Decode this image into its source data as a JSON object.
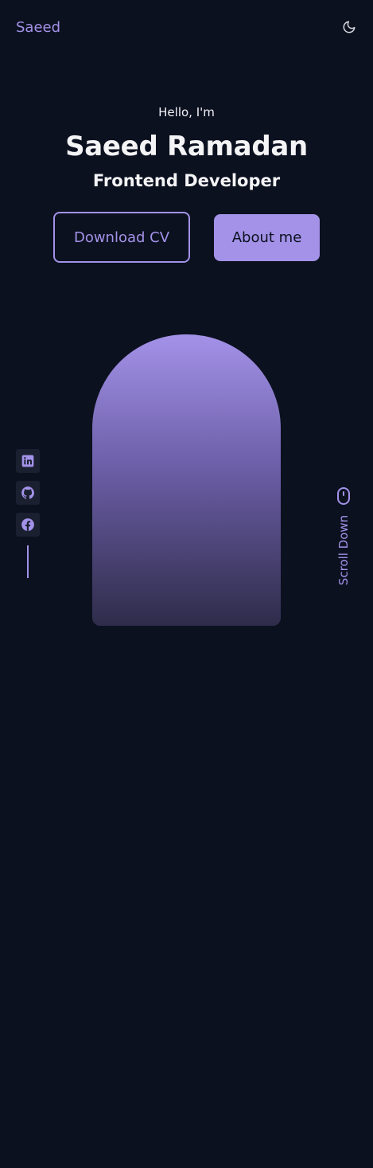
{
  "header": {
    "logo": "Saeed",
    "theme_toggle_icon": "moon-icon"
  },
  "hero": {
    "greeting": "Hello, I'm",
    "name": "Saeed Ramadan",
    "role": "Frontend Developer",
    "buttons": {
      "download_cv": "Download CV",
      "about_me": "About me"
    },
    "scroll_label": "Scroll Down"
  },
  "social": [
    {
      "icon": "linkedin-icon"
    },
    {
      "icon": "github-icon"
    },
    {
      "icon": "facebook-icon"
    }
  ],
  "colors": {
    "background": "#0c1120",
    "accent": "#a392e8",
    "text": "#f4f4f6",
    "social_bg": "#1b2030"
  }
}
